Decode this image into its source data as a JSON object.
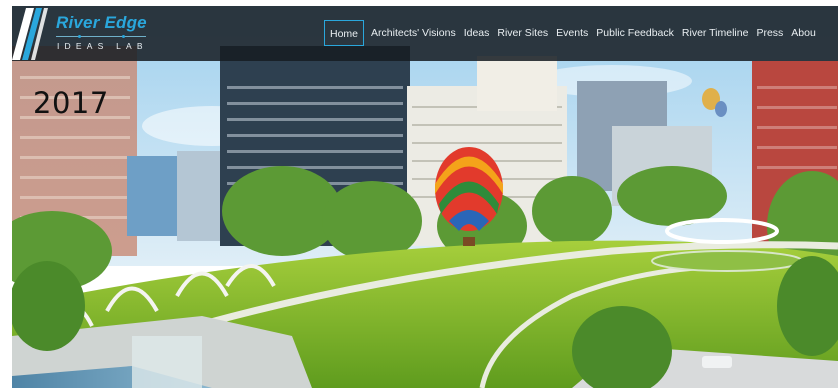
{
  "header": {
    "logo_title": "River Edge",
    "logo_subtitle": "IDEAS LAB",
    "nav": [
      {
        "label": "Home",
        "active": true
      },
      {
        "label": "Architects' Visions",
        "active": false
      },
      {
        "label": "Ideas",
        "active": false
      },
      {
        "label": "River Sites",
        "active": false
      },
      {
        "label": "Events",
        "active": false
      },
      {
        "label": "Public Feedback",
        "active": false
      },
      {
        "label": "River Timeline",
        "active": false
      },
      {
        "label": "Press",
        "active": false
      },
      {
        "label": "Abou",
        "active": false
      }
    ]
  },
  "hero": {
    "year_overlay": "2017"
  },
  "colors": {
    "nav_bg": "#161c22",
    "accent": "#2aa7dc",
    "nav_text": "#e9eef1"
  }
}
